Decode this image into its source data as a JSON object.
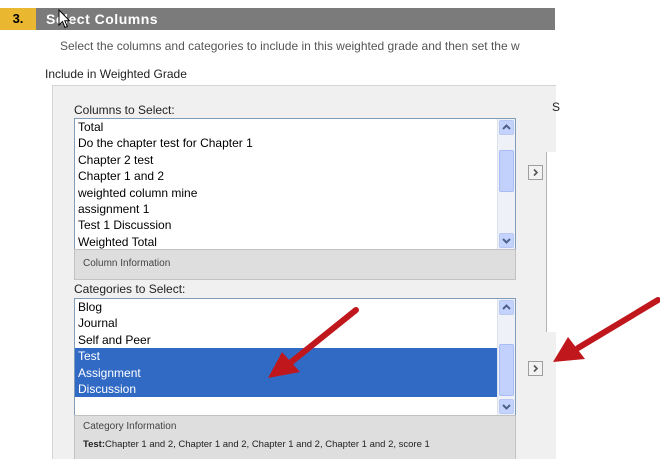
{
  "step": {
    "number": "3.",
    "title": "Select Columns"
  },
  "instructions": "Select the columns and categories to include in this weighted grade and then set the w",
  "include_label": "Include in Weighted Grade",
  "right_header_fragment": "S",
  "columns": {
    "label": "Columns to Select:",
    "items": [
      "Total",
      "Do the chapter test for Chapter 1",
      "Chapter 2 test",
      "Chapter 1 and 2",
      "weighted column mine",
      "assignment 1",
      "Test 1  Discussion",
      "Weighted Total"
    ],
    "info_label": "Column Information"
  },
  "categories": {
    "label": "Categories to Select:",
    "items": [
      {
        "label": "Blog",
        "selected": false
      },
      {
        "label": "Journal",
        "selected": false
      },
      {
        "label": "Self and Peer",
        "selected": false
      },
      {
        "label": "Test",
        "selected": true
      },
      {
        "label": "Assignment",
        "selected": true
      },
      {
        "label": "Discussion",
        "selected": true
      }
    ],
    "info_label": "Category Information",
    "info_detail_key": "Test:",
    "info_detail_value": "Chapter 1 and 2, Chapter 1 and 2, Chapter 1 and 2, Chapter 1 and 2, score 1"
  },
  "move_button_glyph": "›",
  "colors": {
    "step_bar": "#7b7b7b",
    "step_number": "#e9b730",
    "selection": "#316ac5",
    "annotation_arrow": "#c0171c"
  }
}
